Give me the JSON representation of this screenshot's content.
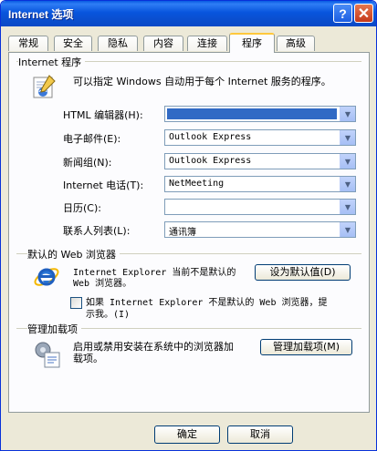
{
  "window": {
    "title": "Internet 选项",
    "help_glyph": "?",
    "close_glyph": "✕"
  },
  "tabs": [
    {
      "label": "常规"
    },
    {
      "label": "安全"
    },
    {
      "label": "隐私"
    },
    {
      "label": "内容"
    },
    {
      "label": "连接"
    },
    {
      "label": "程序",
      "active": true
    },
    {
      "label": "高级"
    }
  ],
  "programs": {
    "group_label": "Internet 程序",
    "description": "可以指定 Windows 自动用于每个 Internet 服务的程序。",
    "icon": "programs-icon",
    "fields": [
      {
        "label": "HTML 编辑器(H):",
        "value": ""
      },
      {
        "label": "电子邮件(E):",
        "value": "Outlook Express"
      },
      {
        "label": "新闻组(N):",
        "value": "Outlook Express"
      },
      {
        "label": "Internet 电话(T):",
        "value": "NetMeeting"
      },
      {
        "label": "日历(C):",
        "value": ""
      },
      {
        "label": "联系人列表(L):",
        "value": "通讯簿"
      }
    ]
  },
  "default_browser": {
    "group_label": "默认的 Web 浏览器",
    "status_line1": "Internet Explorer 当前不是默认的",
    "status_line2": "Web 浏览器。",
    "set_default_label": "设为默认值(D)",
    "check_line1": "如果 Internet Explorer 不是默认的 Web 浏览器，提",
    "check_line2": "示我。(I)",
    "check_checked": false
  },
  "addons": {
    "group_label": "管理加载项",
    "desc_line1": "启用或禁用安装在系统中的浏览器加",
    "desc_line2": "载项。",
    "manage_label": "管理加载项(M)"
  },
  "footer": {
    "ok_label": "确定",
    "cancel_label": "取消"
  }
}
